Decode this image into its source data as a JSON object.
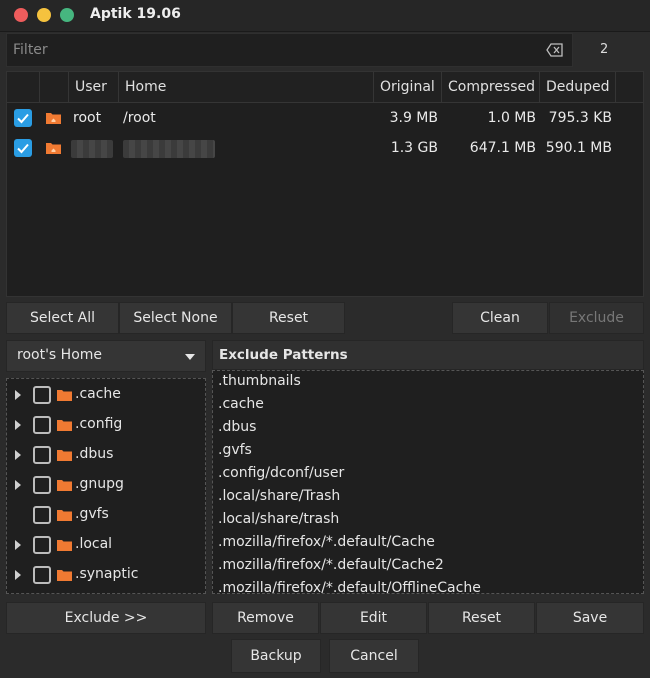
{
  "window": {
    "title": "Aptik 19.06"
  },
  "filter": {
    "placeholder": "Filter",
    "value": "",
    "count": "2"
  },
  "table": {
    "headers": [
      "User",
      "Home",
      "Original",
      "Compressed",
      "Deduped"
    ],
    "rows": [
      {
        "user": "root",
        "home": "/root",
        "original": "3.9 MB",
        "compressed": "1.0 MB",
        "deduped": "795.3 KB",
        "checked": true
      },
      {
        "user": "",
        "home": "",
        "original": "1.3 GB",
        "compressed": "647.1 MB",
        "deduped": "590.1 MB",
        "checked": true
      }
    ]
  },
  "buttons": {
    "select_all": "Select All",
    "select_none": "Select None",
    "reset": "Reset",
    "clean": "Clean",
    "exclude": "Exclude",
    "exclude_add": "Exclude >>",
    "remove": "Remove",
    "edit": "Edit",
    "reset2": "Reset",
    "save": "Save",
    "backup": "Backup",
    "cancel": "Cancel"
  },
  "home_selector": {
    "selected": "root's Home"
  },
  "tree": {
    "items": [
      {
        "label": ".cache",
        "expandable": true
      },
      {
        "label": ".config",
        "expandable": true
      },
      {
        "label": ".dbus",
        "expandable": true
      },
      {
        "label": ".gnupg",
        "expandable": true
      },
      {
        "label": ".gvfs",
        "expandable": false
      },
      {
        "label": ".local",
        "expandable": true
      },
      {
        "label": ".synaptic",
        "expandable": true
      }
    ]
  },
  "exclude": {
    "header": "Exclude Patterns",
    "patterns": [
      ".thumbnails",
      ".cache",
      ".dbus",
      ".gvfs",
      ".config/dconf/user",
      ".local/share/Trash",
      ".local/share/trash",
      ".mozilla/firefox/*.default/Cache",
      ".mozilla/firefox/*.default/Cache2",
      ".mozilla/firefox/*.default/OfflineCache"
    ]
  },
  "colors": {
    "accent": "#2a9de4",
    "folder": "#f07a32",
    "background": "#2b2b2b"
  }
}
